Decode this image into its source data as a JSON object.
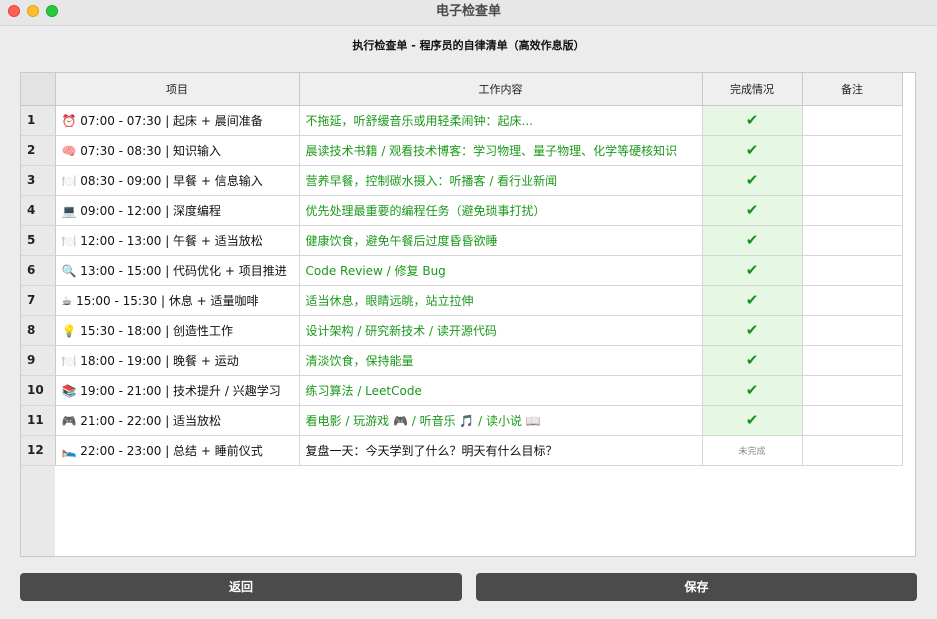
{
  "window": {
    "title": "电子检查单"
  },
  "heading": "执行检查单 - 程序员的自律清单（高效作息版）",
  "columns": [
    "项目",
    "工作内容",
    "完成情况",
    "备注"
  ],
  "rows": [
    {
      "num": "1",
      "item": "⏰ 07:00 - 07:30 | 起床 + 晨间准备",
      "content": "不拖延，听舒缓音乐或用轻柔闹钟：起床...",
      "status": "✔",
      "done": true,
      "note": ""
    },
    {
      "num": "2",
      "item": "🧠 07:30 - 08:30 | 知识输入",
      "content": "晨读技术书籍 / 观看技术博客：学习物理、量子物理、化学等硬核知识",
      "status": "✔",
      "done": true,
      "note": ""
    },
    {
      "num": "3",
      "item": "🍽️ 08:30 - 09:00 | 早餐 + 信息输入",
      "content": "营养早餐，控制碳水摄入：听播客 / 看行业新闻",
      "status": "✔",
      "done": true,
      "note": ""
    },
    {
      "num": "4",
      "item": "💻 09:00 - 12:00 | 深度编程",
      "content": "优先处理最重要的编程任务（避免琐事打扰）",
      "status": "✔",
      "done": true,
      "note": ""
    },
    {
      "num": "5",
      "item": "🍽️ 12:00 - 13:00 | 午餐 + 适当放松",
      "content": "健康饮食，避免午餐后过度昏昏欲睡",
      "status": "✔",
      "done": true,
      "note": ""
    },
    {
      "num": "6",
      "item": "🔍 13:00 - 15:00 | 代码优化 + 项目推进",
      "content": "Code Review / 修复 Bug",
      "status": "✔",
      "done": true,
      "note": ""
    },
    {
      "num": "7",
      "item": "☕ 15:00 - 15:30 | 休息 + 适量咖啡",
      "content": "适当休息，眼睛远眺，站立拉伸",
      "status": "✔",
      "done": true,
      "note": ""
    },
    {
      "num": "8",
      "item": "💡 15:30 - 18:00 | 创造性工作",
      "content": "设计架构 / 研究新技术 / 读开源代码",
      "status": "✔",
      "done": true,
      "note": ""
    },
    {
      "num": "9",
      "item": "🍽️ 18:00 - 19:00 | 晚餐 + 运动",
      "content": "清淡饮食，保持能量",
      "status": "✔",
      "done": true,
      "note": ""
    },
    {
      "num": "10",
      "item": "📚 19:00 - 21:00 | 技术提升 / 兴趣学习",
      "content": "练习算法 / LeetCode",
      "status": "✔",
      "done": true,
      "note": ""
    },
    {
      "num": "11",
      "item": "🎮 21:00 - 22:00 | 适当放松",
      "content": "看电影 / 玩游戏 🎮 / 听音乐 🎵 / 读小说 📖",
      "status": "✔",
      "done": true,
      "note": ""
    },
    {
      "num": "12",
      "item": "🛌 22:00 - 23:00 | 总结 + 睡前仪式",
      "content": "复盘一天：今天学到了什么？明天有什么目标？",
      "status": "未完成",
      "done": false,
      "note": ""
    }
  ],
  "buttons": {
    "back": "返回",
    "save": "保存"
  },
  "colors": {
    "done_bg": "#e6f8e4",
    "done_text": "#1b9a1b",
    "button_bg": "#4b4b4b"
  }
}
